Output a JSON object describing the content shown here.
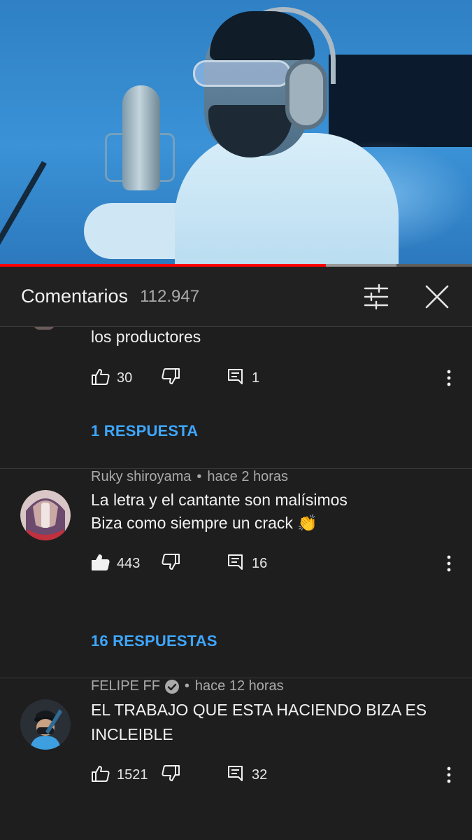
{
  "player": {
    "progress_played": 0.69,
    "progress_buffered": 0.84
  },
  "header": {
    "title": "Comentarios",
    "count": "112.947",
    "icons": [
      "sliders-icon",
      "close-icon"
    ]
  },
  "comments": [
    {
      "text": "los productores",
      "likes": "30",
      "replies_count": "1",
      "replies_label": "1 RESPUESTA",
      "liked": false
    },
    {
      "author": "Ruky shiroyama",
      "time": "hace 2 horas",
      "line1": "La letra y el cantante son malísimos",
      "line2": "Biza como siempre un crack 👏",
      "likes": "443",
      "replies_count": "16",
      "replies_label": "16 RESPUESTAS",
      "liked": true
    },
    {
      "author": "FELIPE FF",
      "verified": true,
      "time": "hace 12 horas",
      "line1": "EL TRABAJO QUE ESTA HACIENDO BIZA ES",
      "line2": "INCLEIBLE",
      "likes": "1521",
      "replies_count": "32",
      "liked": false
    }
  ],
  "colors": {
    "background": "#1e1e1e",
    "header": "#212121",
    "accent_link": "#3ea6ff",
    "progress": "#ff0000"
  }
}
